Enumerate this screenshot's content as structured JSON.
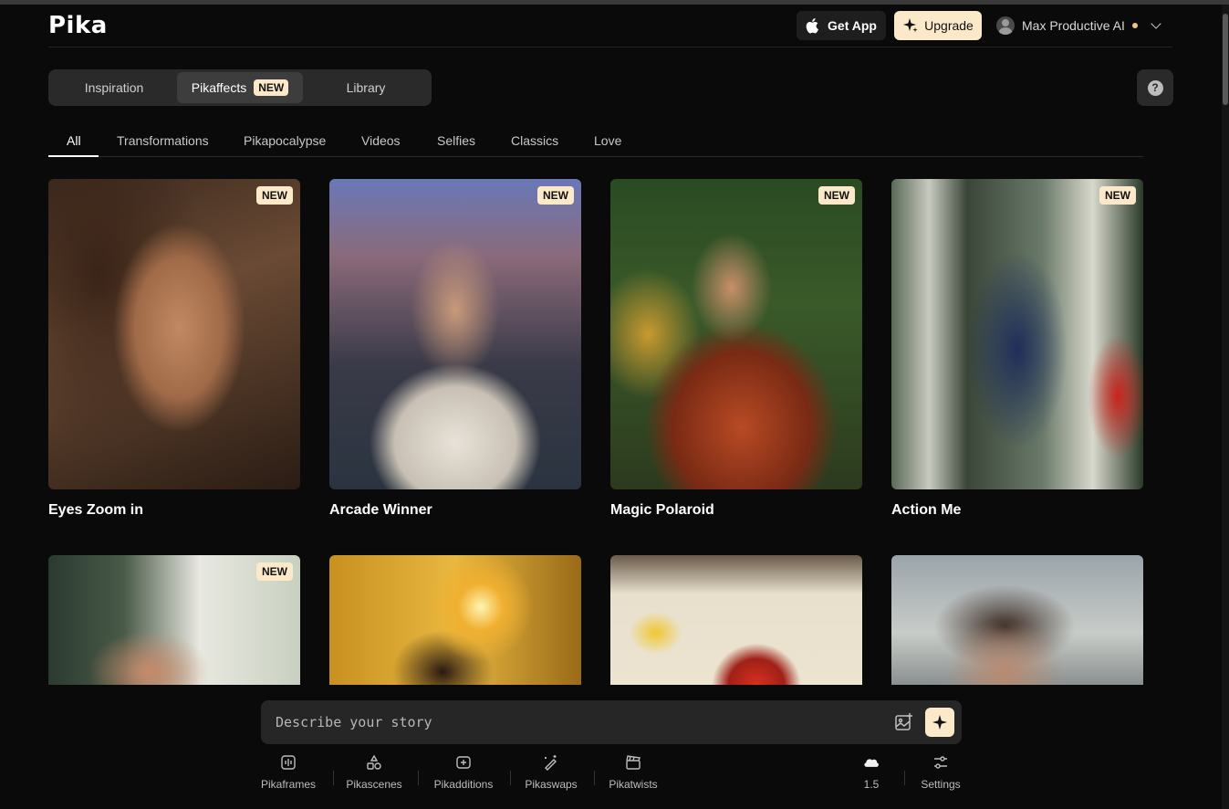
{
  "header": {
    "logo": "Pika",
    "get_app": "Get App",
    "upgrade": "Upgrade",
    "user_name": "Max Productive AI"
  },
  "main_tabs": [
    {
      "label": "Inspiration",
      "active": false
    },
    {
      "label": "Pikaffects",
      "active": true,
      "badge": "NEW"
    },
    {
      "label": "Library",
      "active": false
    }
  ],
  "help_label": "?",
  "categories": [
    "All",
    "Transformations",
    "Pikapocalypse",
    "Videos",
    "Selfies",
    "Classics",
    "Love"
  ],
  "active_category": "All",
  "badge_new": "NEW",
  "effects": [
    {
      "title": "Eyes Zoom in",
      "badge": "NEW"
    },
    {
      "title": "Arcade Winner",
      "badge": "NEW"
    },
    {
      "title": "Magic Polaroid",
      "badge": "NEW"
    },
    {
      "title": "Action Me",
      "badge": "NEW"
    },
    {
      "title": "",
      "badge": "NEW"
    },
    {
      "title": "",
      "badge": ""
    },
    {
      "title": "",
      "badge": ""
    },
    {
      "title": "",
      "badge": ""
    }
  ],
  "prompt": {
    "placeholder": "Describe your story"
  },
  "tools": [
    {
      "label": "Pikaframes"
    },
    {
      "label": "Pikascenes"
    },
    {
      "label": "Pikadditions"
    },
    {
      "label": "Pikaswaps"
    },
    {
      "label": "Pikatwists"
    },
    {
      "label": "1.5"
    },
    {
      "label": "Settings"
    }
  ],
  "colors": {
    "accent": "#fbe9c9",
    "background": "#0a0a0a",
    "surface": "#2a2a2a",
    "status_dot": "#f2c57c"
  }
}
